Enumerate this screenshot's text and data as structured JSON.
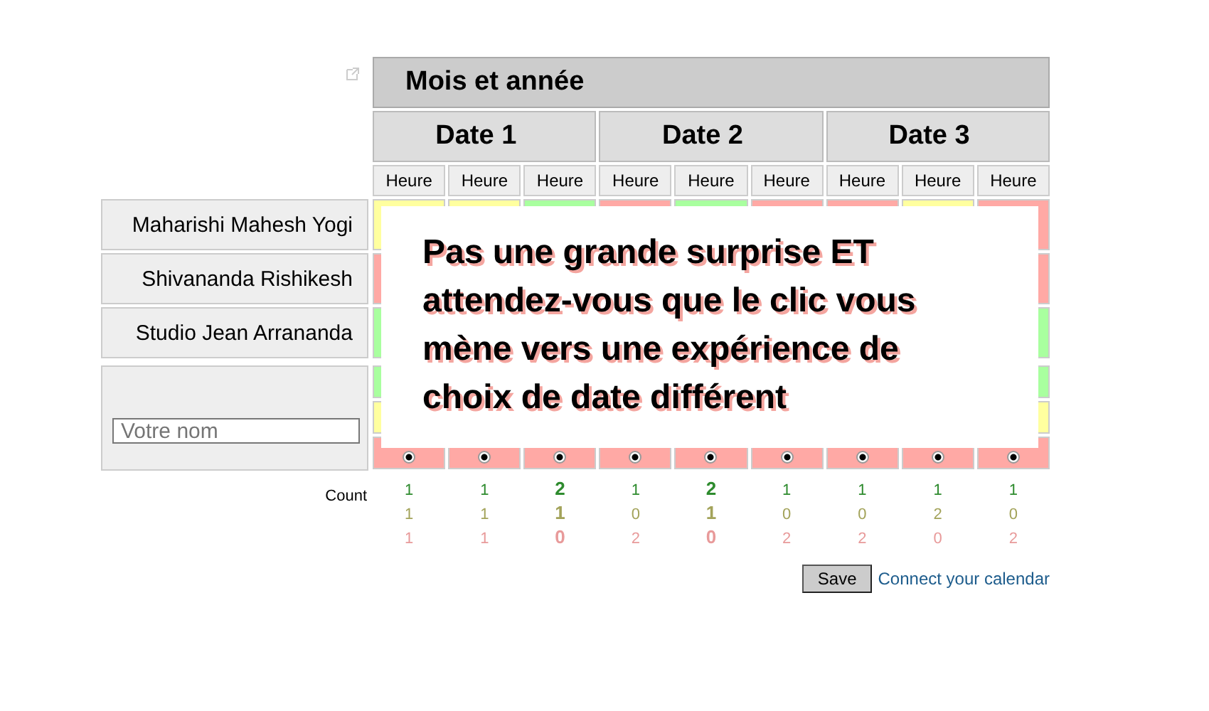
{
  "header": {
    "title": "Mois et année"
  },
  "dates": [
    {
      "label": "Date 1",
      "times": [
        "Heure",
        "Heure",
        "Heure"
      ]
    },
    {
      "label": "Date 2",
      "times": [
        "Heure",
        "Heure",
        "Heure"
      ]
    },
    {
      "label": "Date 3",
      "times": [
        "Heure",
        "Heure",
        "Heure"
      ]
    }
  ],
  "participants": [
    {
      "name": "Maharishi Mahesh Yogi",
      "votes": [
        {
          "color": "#ffff9f"
        },
        {
          "color": "#ffff9f"
        },
        {
          "color": "#a9ff9f"
        },
        {
          "color": "#ffa9a5"
        },
        {
          "color": "#a9ff9f"
        },
        {
          "color": "#ffa9a5"
        },
        {
          "color": "#ffa9a5"
        },
        {
          "color": "#ffff9f"
        },
        {
          "color": "#ffa9a5"
        }
      ]
    },
    {
      "name": "Shivananda Rishikesh",
      "votes": [
        {
          "color": "#ffa9a5"
        },
        {
          "color": "#ffa9a5"
        }
      ]
    },
    {
      "name": "Studio Jean Arrananda",
      "votes": [
        {
          "color": "#a9ff9f"
        },
        {
          "color": "#a9ff9f"
        }
      ]
    }
  ],
  "new_entry": {
    "placeholder": "Votre nom",
    "columns": [
      {
        "no_selected": true
      },
      {
        "no_selected": true
      },
      {
        "no_selected": true
      },
      {
        "no_selected": true
      },
      {
        "no_selected": true
      },
      {
        "no_selected": true
      },
      {
        "no_selected": true
      },
      {
        "no_selected": true
      },
      {
        "no_selected": true
      }
    ]
  },
  "counts": {
    "label": "Count",
    "yes": [
      {
        "value": "1",
        "top": false
      },
      {
        "value": "1",
        "top": false
      },
      {
        "value": "2",
        "top": true
      },
      {
        "value": "1",
        "top": false
      },
      {
        "value": "2",
        "top": true
      },
      {
        "value": "1",
        "top": false
      },
      {
        "value": "1",
        "top": false
      },
      {
        "value": "1",
        "top": false
      },
      {
        "value": "1",
        "top": false
      }
    ],
    "maybe": [
      {
        "value": "1",
        "top": false
      },
      {
        "value": "1",
        "top": false
      },
      {
        "value": "1",
        "top": true
      },
      {
        "value": "0",
        "top": false
      },
      {
        "value": "1",
        "top": true
      },
      {
        "value": "0",
        "top": false
      },
      {
        "value": "0",
        "top": false
      },
      {
        "value": "2",
        "top": false
      },
      {
        "value": "0",
        "top": false
      }
    ],
    "no": [
      {
        "value": "1",
        "top": false
      },
      {
        "value": "1",
        "top": false
      },
      {
        "value": "0",
        "top": true
      },
      {
        "value": "2",
        "top": false
      },
      {
        "value": "0",
        "top": true
      },
      {
        "value": "2",
        "top": false
      },
      {
        "value": "2",
        "top": false
      },
      {
        "value": "0",
        "top": false
      },
      {
        "value": "2",
        "top": false
      }
    ]
  },
  "actions": {
    "save": "Save",
    "link": "Connect your calendar"
  },
  "overlay": {
    "message": "Pas une grande surprise ET attendez-vous que le clic vous mène vers une expérience de choix de date différent"
  }
}
